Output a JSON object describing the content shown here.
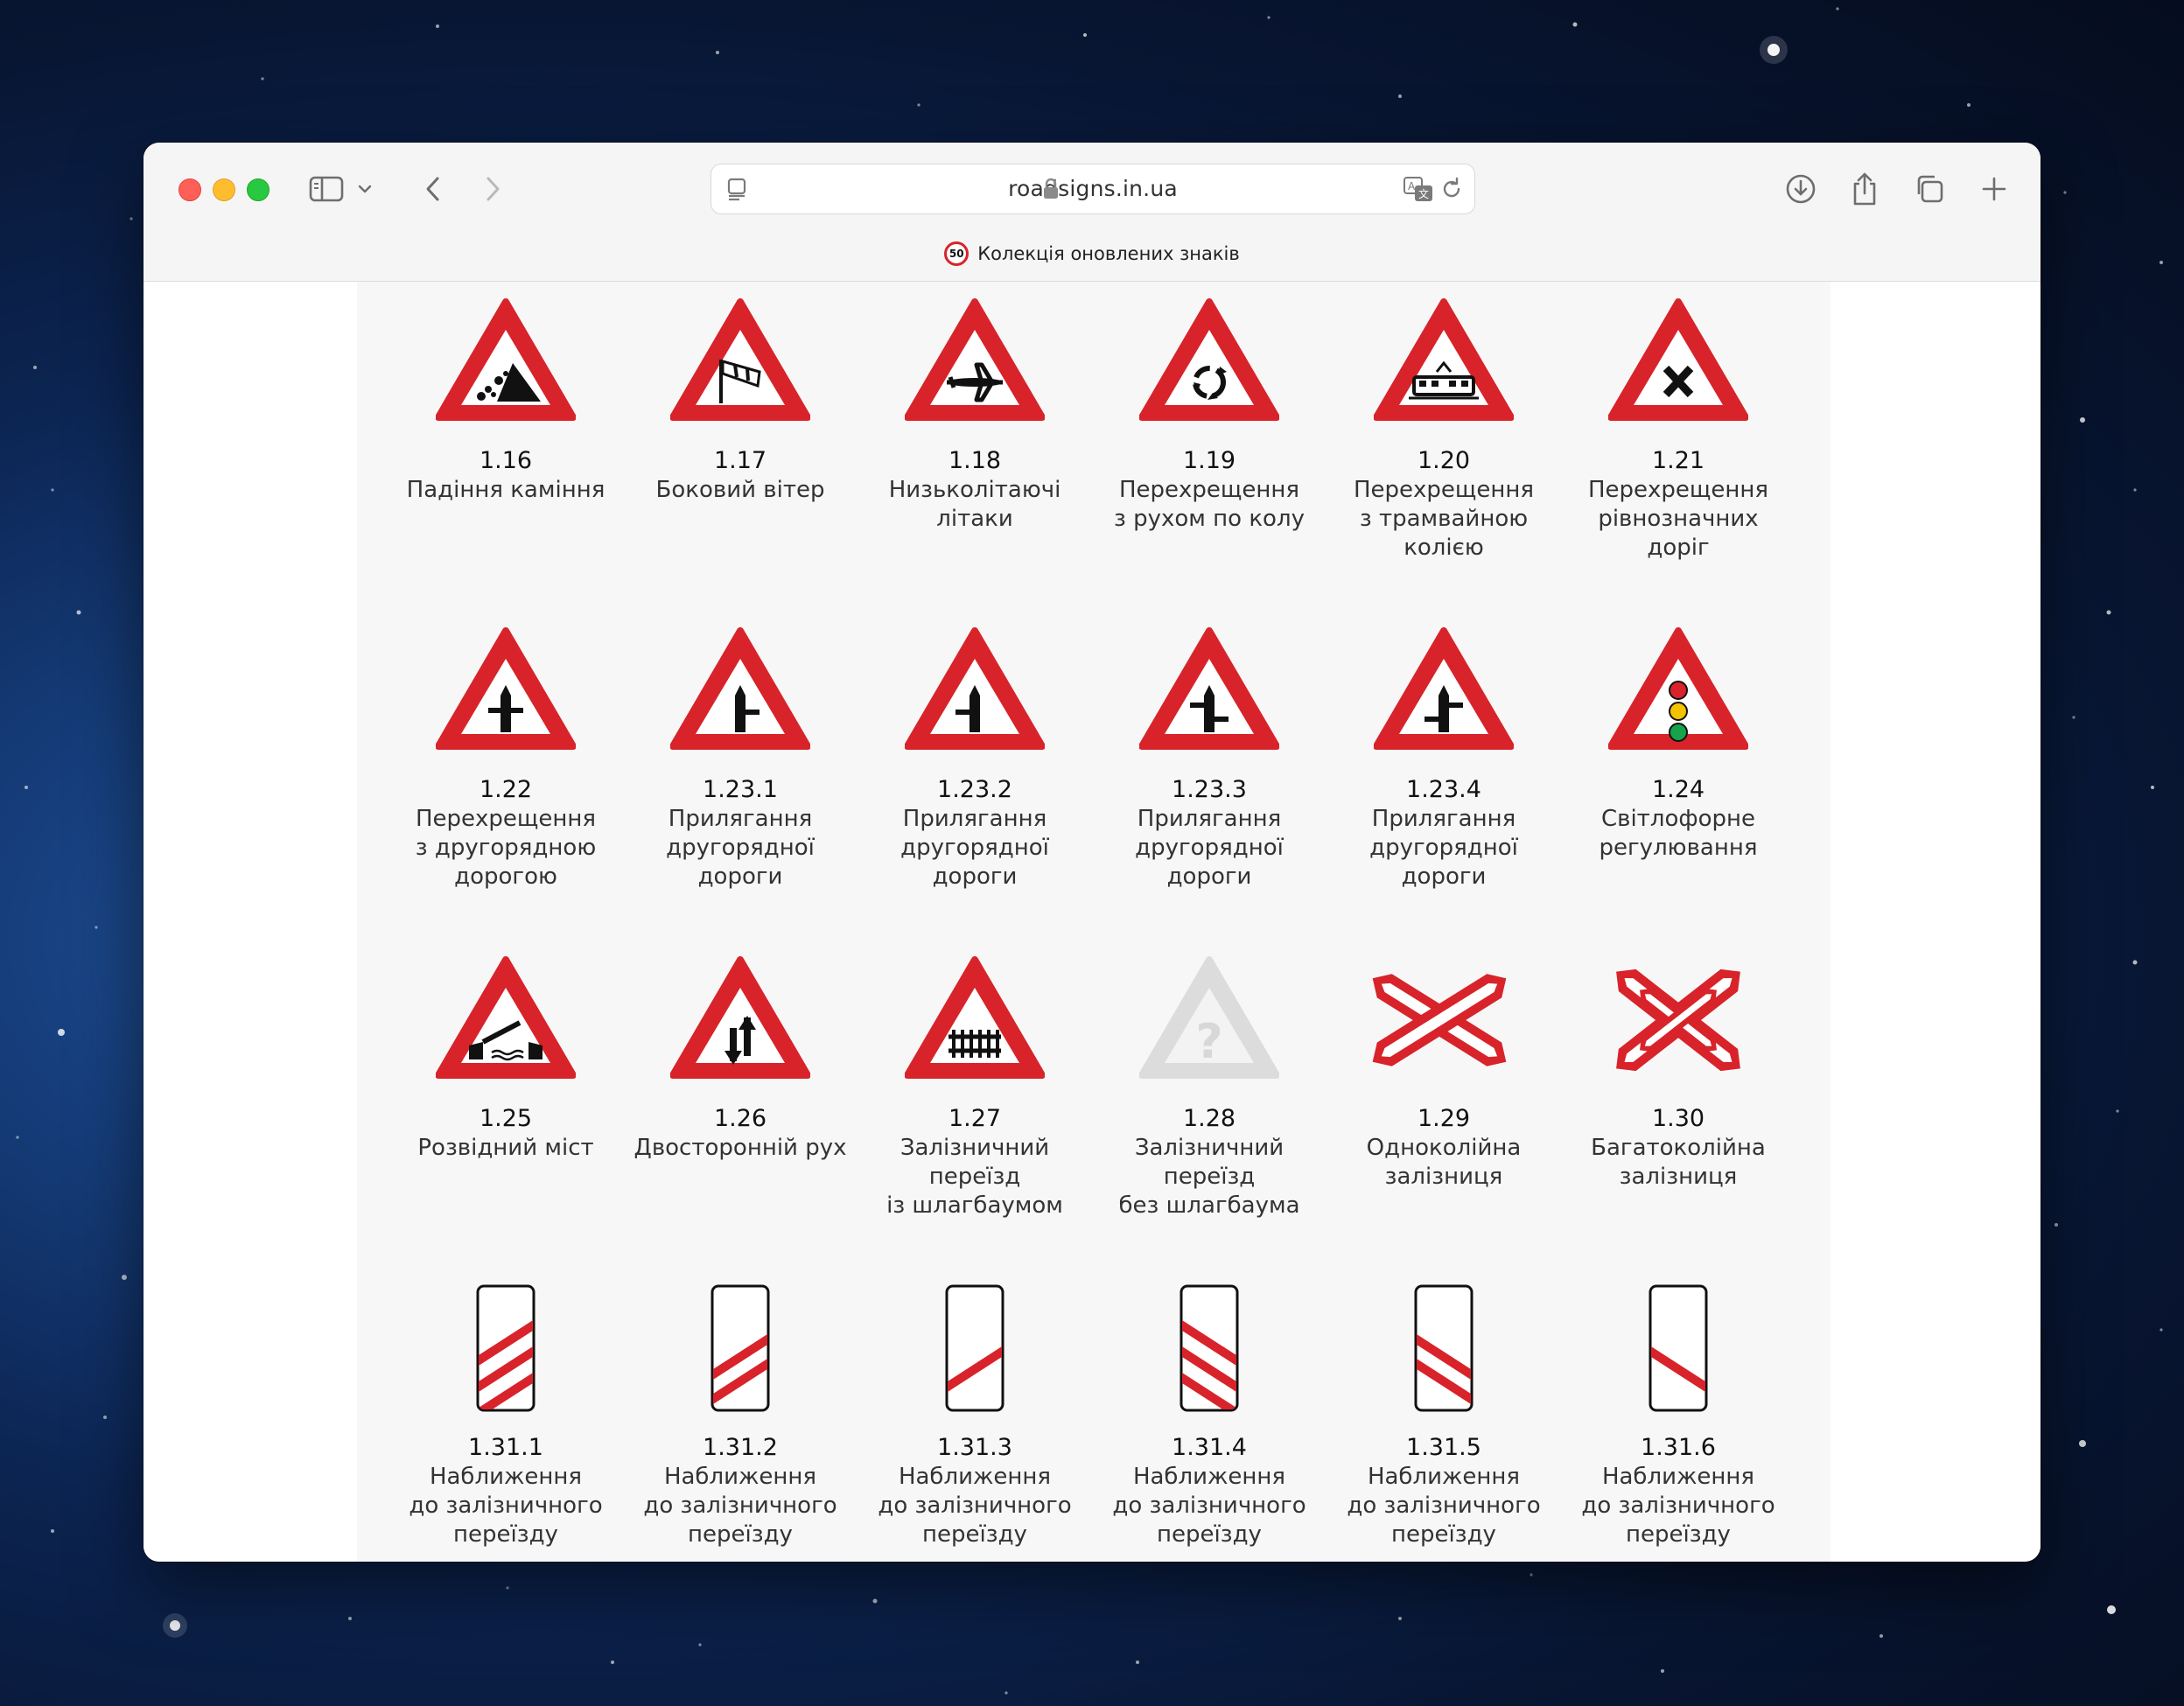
{
  "browser": {
    "url": "roadsigns.in.ua",
    "banner_text": "Колекція оновлених знаків",
    "banner_badge": "50"
  },
  "colors": {
    "sign_red": "#d8232a",
    "page_bg": "#f7f7f7",
    "toolbar_bg": "#f6f5f5"
  },
  "rows": [
    [
      {
        "code": "1.16",
        "name": "Падіння каміння",
        "icon": "falling-rocks-sign-icon"
      },
      {
        "code": "1.17",
        "name": "Боковий вітер",
        "icon": "crosswind-sign-icon"
      },
      {
        "code": "1.18",
        "name": "Низьколітаючі\nлітаки",
        "icon": "low-flying-aircraft-sign-icon"
      },
      {
        "code": "1.19",
        "name": "Перехрещення\nз рухом по колу",
        "icon": "roundabout-sign-icon"
      },
      {
        "code": "1.20",
        "name": "Перехрещення\nз трамвайною\nколією",
        "icon": "tram-crossing-sign-icon"
      },
      {
        "code": "1.21",
        "name": "Перехрещення\nрівнозначних\nдоріг",
        "icon": "equal-roads-crossing-sign-icon"
      }
    ],
    [
      {
        "code": "1.22",
        "name": "Перехрещення\nз другорядною\nдорогою",
        "icon": "minor-road-crossing-sign-icon"
      },
      {
        "code": "1.23.1",
        "name": "Прилягання\nдругорядної\nдороги",
        "icon": "minor-road-right-sign-icon"
      },
      {
        "code": "1.23.2",
        "name": "Прилягання\nдругорядної\nдороги",
        "icon": "minor-road-left-sign-icon"
      },
      {
        "code": "1.23.3",
        "name": "Прилягання\nдругорядної\nдороги",
        "icon": "minor-road-staggered-right-sign-icon"
      },
      {
        "code": "1.23.4",
        "name": "Прилягання\nдругорядної\nдороги",
        "icon": "minor-road-staggered-left-sign-icon"
      },
      {
        "code": "1.24",
        "name": "Світлофорне\nрегулювання",
        "icon": "traffic-lights-sign-icon"
      }
    ],
    [
      {
        "code": "1.25",
        "name": "Розвідний міст",
        "icon": "drawbridge-sign-icon"
      },
      {
        "code": "1.26",
        "name": "Двосторонній рух",
        "icon": "two-way-traffic-sign-icon"
      },
      {
        "code": "1.27",
        "name": "Залізничний\nпереїзд\nіз шлагбаумом",
        "icon": "railway-crossing-barrier-sign-icon"
      },
      {
        "code": "1.28",
        "name": "Залізничний\nпереїзд\nбез шлагбаума",
        "icon": "unknown-sign-placeholder-icon"
      },
      {
        "code": "1.29",
        "name": "Одноколійна\nзалізниця",
        "icon": "single-track-cross-sign-icon"
      },
      {
        "code": "1.30",
        "name": "Багатоколійна\nзалізниця",
        "icon": "multi-track-cross-sign-icon"
      }
    ],
    [
      {
        "code": "1.31.1",
        "name": "Наближення\nдо залізничного\nпереїзду",
        "icon": "approach-3-stripes-left-sign-icon"
      },
      {
        "code": "1.31.2",
        "name": "Наближення\nдо залізничного\nпереїзду",
        "icon": "approach-2-stripes-left-sign-icon"
      },
      {
        "code": "1.31.3",
        "name": "Наближення\nдо залізничного\nпереїзду",
        "icon": "approach-1-stripe-left-sign-icon"
      },
      {
        "code": "1.31.4",
        "name": "Наближення\nдо залізничного\nпереїзду",
        "icon": "approach-3-stripes-right-sign-icon"
      },
      {
        "code": "1.31.5",
        "name": "Наближення\nдо залізничного\nпереїзду",
        "icon": "approach-2-stripes-right-sign-icon"
      },
      {
        "code": "1.31.6",
        "name": "Наближення\nдо залізничного\nпереїзду",
        "icon": "approach-1-stripe-right-sign-icon"
      }
    ]
  ]
}
